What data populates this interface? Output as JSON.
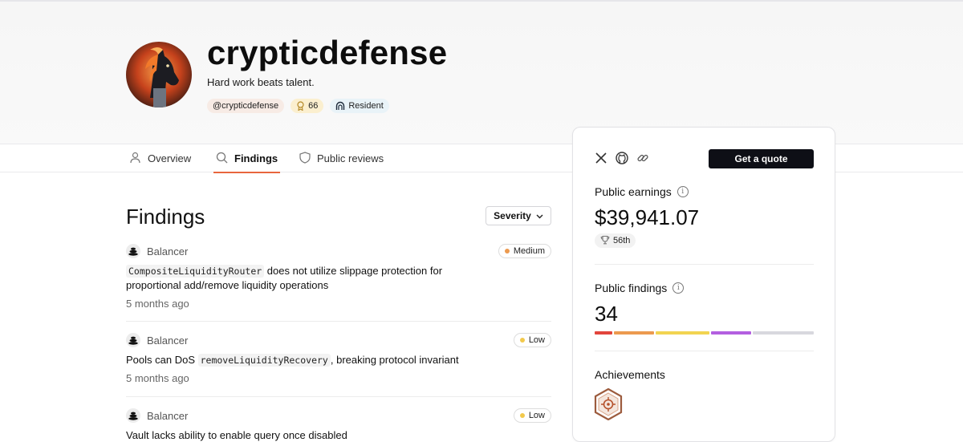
{
  "profile": {
    "name": "crypticdefense",
    "tagline": "Hard work beats talent.",
    "handle": "@crypticdefense",
    "points": "66",
    "role": "Resident"
  },
  "tabs": [
    {
      "label": "Overview",
      "icon": "user-icon",
      "active": false
    },
    {
      "label": "Findings",
      "icon": "search-icon",
      "active": true
    },
    {
      "label": "Public reviews",
      "icon": "shield-icon",
      "active": false
    }
  ],
  "findings": {
    "title": "Findings",
    "filter_label": "Severity",
    "items": [
      {
        "project": "Balancer",
        "severity": "Medium",
        "title_code": "CompositeLiquidityRouter",
        "title_text": " does not utilize slippage protection for proportional add/remove liquidity operations",
        "time": "5 months ago"
      },
      {
        "project": "Balancer",
        "severity": "Low",
        "title_pre": "Pools can DoS ",
        "title_code": "removeLiquidityRecovery",
        "title_post": ", breaking protocol invariant",
        "time": "5 months ago"
      },
      {
        "project": "Balancer",
        "severity": "Low",
        "title_text": "Vault lacks ability to enable query once disabled"
      }
    ]
  },
  "sidebar": {
    "social_icons": [
      "x-icon",
      "github-icon",
      "link-icon"
    ],
    "quote_button": "Get a quote",
    "earnings_label": "Public earnings",
    "earnings_value": "$39,941.07",
    "rank": "56th",
    "findings_label": "Public findings",
    "findings_count": "34",
    "severity_colors": [
      "#e2453c",
      "#ec9a4f",
      "#f2d451",
      "#b35fe0",
      "#d8d8de"
    ],
    "achievements_label": "Achievements",
    "achievement_icon": "hexagon-badge-icon"
  },
  "colors": {
    "accent": "#e8663d",
    "medium": "#ec9a4f",
    "low": "#f2c94c",
    "button_dark": "#0e0f16"
  }
}
